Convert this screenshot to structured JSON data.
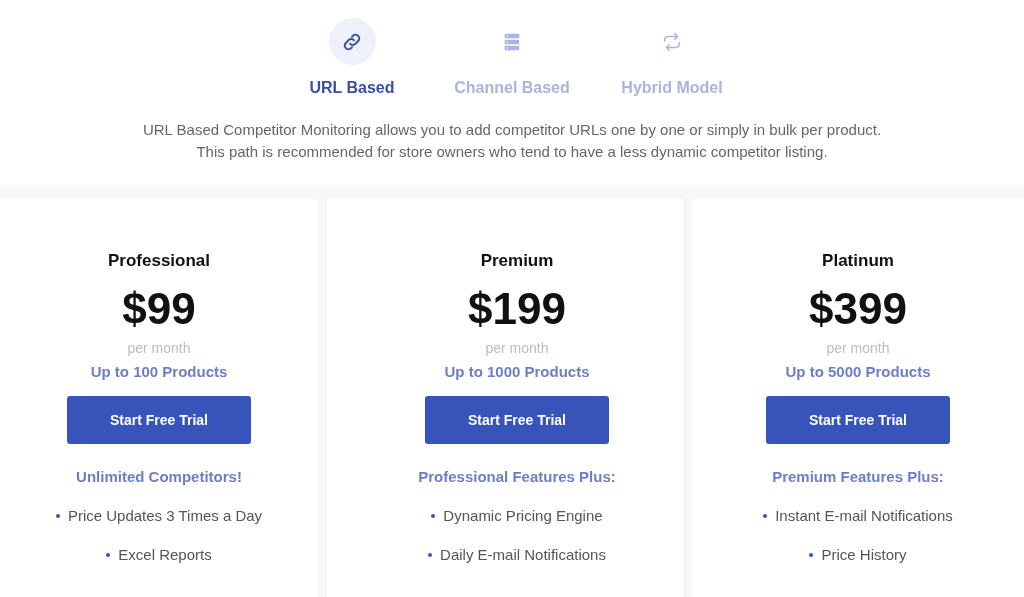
{
  "tabs": [
    {
      "label": "URL Based",
      "kind": "link",
      "selected": true
    },
    {
      "label": "Channel Based",
      "kind": "server",
      "selected": false
    },
    {
      "label": "Hybrid Model",
      "kind": "repeat",
      "selected": false
    }
  ],
  "description": [
    "URL Based Competitor Monitoring allows you to add competitor URLs one by one or simply in bulk per product.",
    "This path is recommended for store owners who tend to have a less dynamic competitor listing."
  ],
  "plans": [
    {
      "name": "Professional",
      "price": "$99",
      "period": "per month",
      "products": "Up to 100 Products",
      "button": "Start Free Trial",
      "features_heading": "Unlimited Competitors!",
      "features": [
        "Price Updates 3 Times a Day",
        "Excel Reports"
      ]
    },
    {
      "name": "Premium",
      "price": "$199",
      "period": "per month",
      "products": "Up to 1000 Products",
      "button": "Start Free Trial",
      "features_heading": "Professional Features Plus:",
      "features": [
        "Dynamic Pricing Engine",
        "Daily E-mail Notifications"
      ]
    },
    {
      "name": "Platinum",
      "price": "$399",
      "period": "per month",
      "products": "Up to 5000 Products",
      "button": "Start Free Trial",
      "features_heading": "Premium Features Plus:",
      "features": [
        "Instant E-mail Notifications",
        "Price History"
      ]
    }
  ]
}
